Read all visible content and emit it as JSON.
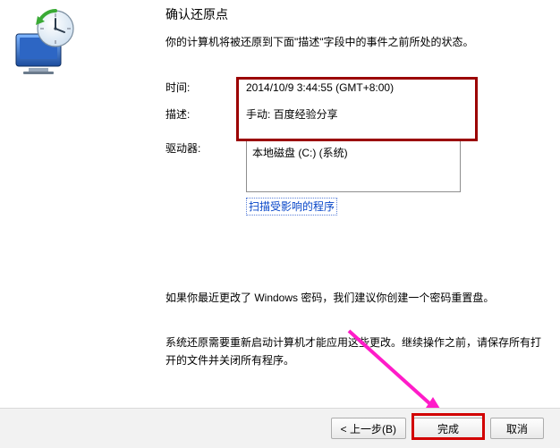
{
  "title": "确认还原点",
  "intro": "你的计算机将被还原到下面\"描述\"字段中的事件之前所处的状态。",
  "fields": {
    "time_label": "时间:",
    "time_value": "2014/10/9 3:44:55 (GMT+8:00)",
    "desc_label": "描述:",
    "desc_value": "手动: 百度经验分享",
    "drives_label": "驱动器:",
    "drives_value": "本地磁盘 (C:) (系统)"
  },
  "scan_link": "扫描受影响的程序",
  "para1": "如果你最近更改了 Windows 密码，我们建议你创建一个密码重置盘。",
  "para2": "系统还原需要重新启动计算机才能应用这些更改。继续操作之前，请保存所有打开的文件并关闭所有程序。",
  "buttons": {
    "back": "< 上一步(B)",
    "finish": "完成",
    "cancel": "取消"
  },
  "icons": {
    "restore": "system-restore-icon"
  }
}
